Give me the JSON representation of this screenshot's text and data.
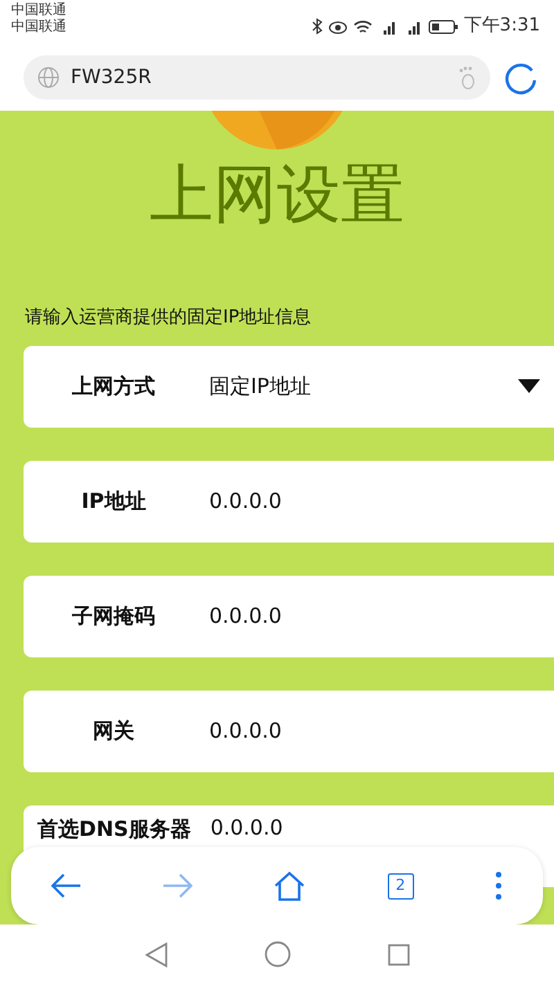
{
  "status_bar": {
    "carriers": [
      "中国联通",
      "中国联通"
    ],
    "time": "下午3:31"
  },
  "address_bar": {
    "url": "FW325R"
  },
  "page": {
    "title": "上网设置",
    "instruction": "请输入运营商提供的固定IP地址信息",
    "fields": [
      {
        "label": "上网方式",
        "value": "固定IP地址",
        "kind": "select"
      },
      {
        "label": "IP地址",
        "value": "0.0.0.0",
        "kind": "text"
      },
      {
        "label": "子网掩码",
        "value": "0.0.0.0",
        "kind": "text"
      },
      {
        "label": "网关",
        "value": "0.0.0.0",
        "kind": "text"
      },
      {
        "label": "首选DNS服务器",
        "value": "0.0.0.0",
        "kind": "text"
      }
    ]
  },
  "toolbar": {
    "tab_count": "2"
  }
}
